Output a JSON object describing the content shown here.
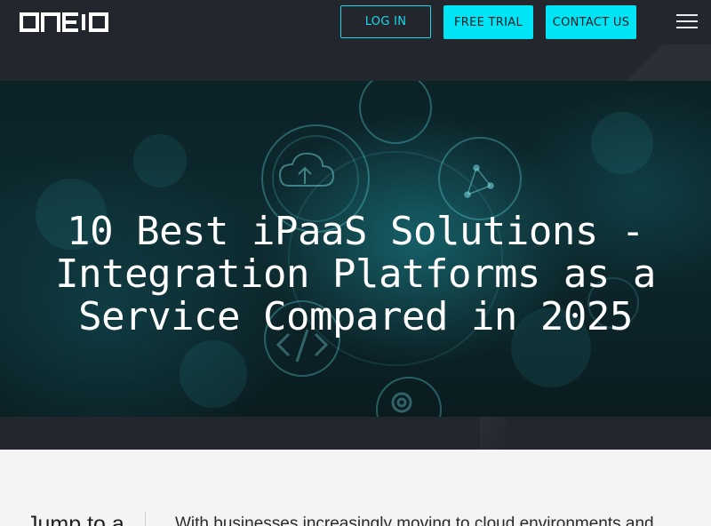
{
  "header": {
    "logo_text": "ONEIO",
    "login_label": "LOG IN",
    "trial_label": "FREE TRIAL",
    "contact_label": "CONTACT US",
    "menu_icon": "hamburger-icon"
  },
  "hero": {
    "title_line1": "10 Best iPaaS Solutions -",
    "title_line2": "Integration Platforms as a",
    "title_line3": "Service Compared in 2025",
    "decor_icons": [
      "cloud-upload-icon",
      "network-icon",
      "code-icon",
      "gear-icon"
    ]
  },
  "content": {
    "jump_label": "Jump to a",
    "intro_text": "With businesses increasingly moving to cloud environments and"
  },
  "colors": {
    "header_bg": "#23262d",
    "accent": "#00e5f5",
    "hero_text": "#ffffff",
    "page_bg": "#f4f4f4"
  }
}
